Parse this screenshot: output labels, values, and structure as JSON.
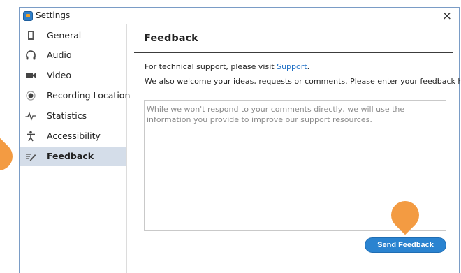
{
  "window": {
    "title": "Settings",
    "close_label": "×"
  },
  "sidebar": {
    "items": [
      {
        "label": "General",
        "icon": "phone-icon"
      },
      {
        "label": "Audio",
        "icon": "headphones-icon"
      },
      {
        "label": "Video",
        "icon": "camera-icon"
      },
      {
        "label": "Recording Location",
        "icon": "record-icon"
      },
      {
        "label": "Statistics",
        "icon": "pulse-icon"
      },
      {
        "label": "Accessibility",
        "icon": "accessibility-icon"
      },
      {
        "label": "Feedback",
        "icon": "feedback-pen-icon",
        "active": true
      }
    ]
  },
  "main": {
    "title": "Feedback",
    "support_prefix": "For technical support, please visit ",
    "support_link": "Support",
    "support_suffix": ".",
    "welcome_text": "We also welcome your ideas, requests or comments. Please enter your feedback here:",
    "feedback_placeholder": "While we won't respond to your comments directly, we will use the information you provide to improve our support resources.",
    "send_label": "Send Feedback"
  },
  "colors": {
    "accent": "#2a83d0",
    "active_bg": "#d4dde9",
    "marker": "#f39b42"
  }
}
